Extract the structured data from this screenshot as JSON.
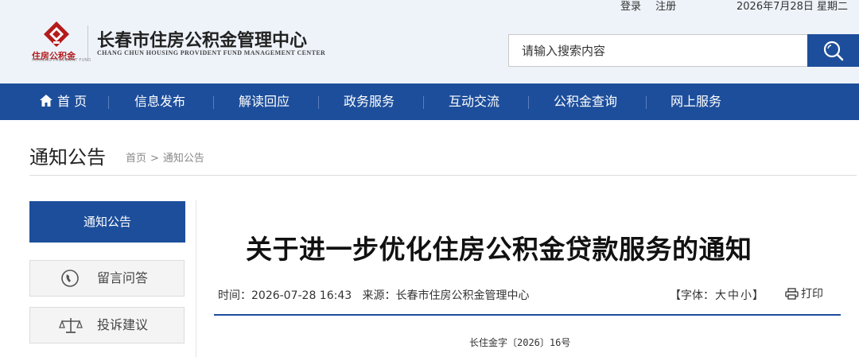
{
  "topbar": {
    "login": "登录",
    "register": "注册",
    "date": "2026年7月28日 星期二"
  },
  "logo": {
    "title": "长春市住房公积金管理中心",
    "subtitle": "CHANG CHUN HOUSING PROVIDENT FUND MANAGEMENT CENTER",
    "mark_text": "住房公积金",
    "mark_subtext": "HOUSING PROVIDENT FUND",
    "mark_color": "#b41b1b"
  },
  "search": {
    "placeholder": "请输入搜索内容",
    "icon": "search-icon"
  },
  "nav": {
    "color": "#1d4e9b",
    "home_icon": "home-icon",
    "items": [
      "首 页",
      "信息发布",
      "解读回应",
      "政务服务",
      "互动交流",
      "公积金查询",
      "网上服务"
    ]
  },
  "page": {
    "title": "通知公告",
    "breadcrumb": [
      "首页",
      "通知公告"
    ],
    "breadcrumb_sep": ">"
  },
  "sidebar": {
    "active": "通知公告",
    "items": [
      {
        "label": "留言问答",
        "icon": "phone-icon"
      },
      {
        "label": "投诉建议",
        "icon": "scales-icon"
      }
    ]
  },
  "article": {
    "title": "关于进一步优化住房公积金贷款服务的通知",
    "time_label": "时间：",
    "time": "2026-07-28 16:43",
    "source_label": "来源：",
    "source": "长春市住房公积金管理中心",
    "font_label_open": "【字体：",
    "font_sizes": [
      "大",
      "中",
      "小"
    ],
    "font_label_close": "】",
    "print_label": "打印",
    "doc_number": "长住金字〔2026〕16号"
  }
}
